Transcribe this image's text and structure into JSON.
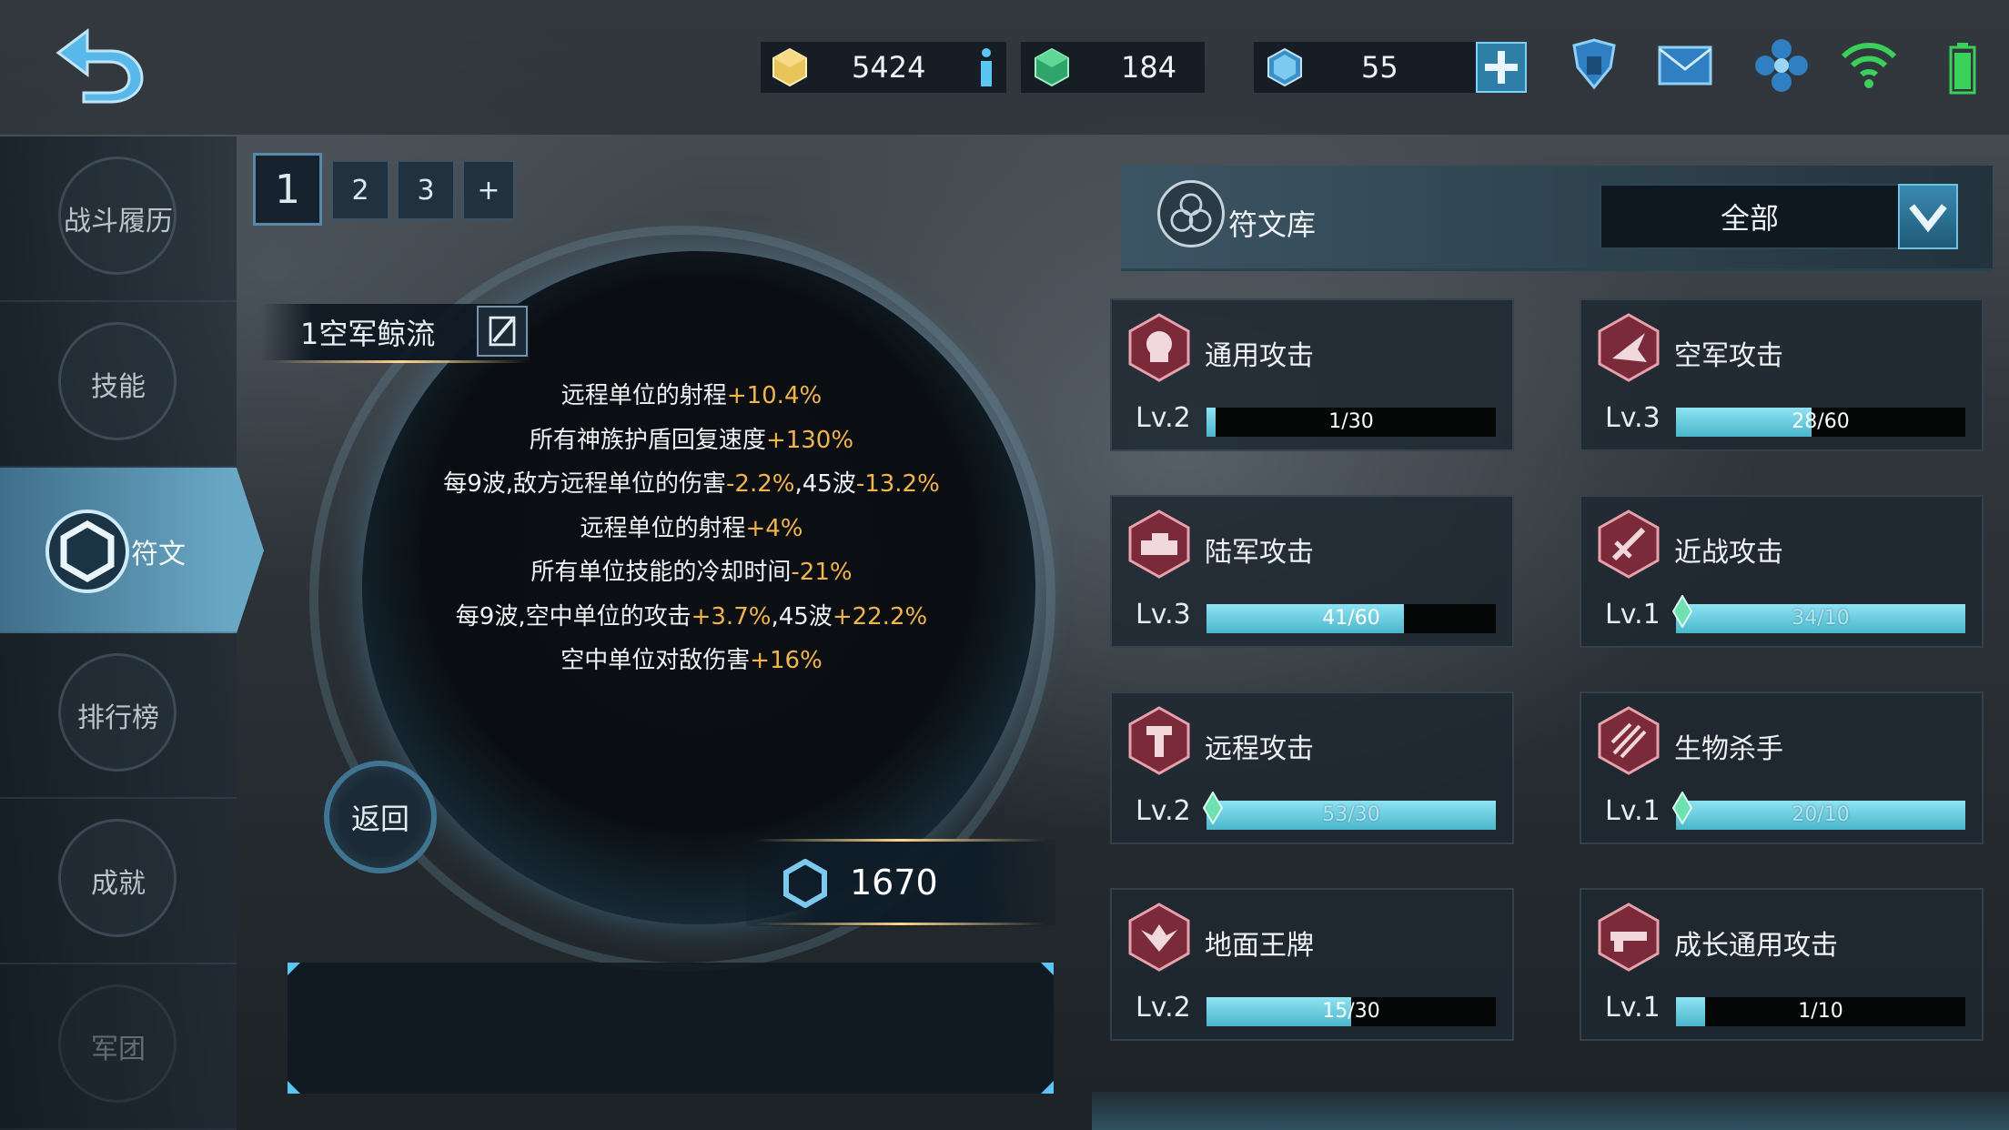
{
  "resources": [
    {
      "name": "gold",
      "value": "5424",
      "color": "#e8c35a"
    },
    {
      "name": "crystal",
      "value": "184",
      "color": "#36c27a"
    },
    {
      "name": "energy",
      "value": "55",
      "color": "#58b7e8"
    }
  ],
  "sidebar": {
    "items": [
      {
        "label": "战斗履历"
      },
      {
        "label": "技能"
      },
      {
        "label": "符文"
      },
      {
        "label": "排行榜"
      },
      {
        "label": "成就"
      },
      {
        "label": "军团"
      }
    ]
  },
  "tabs": [
    "1",
    "2",
    "3",
    "+"
  ],
  "rune_set": {
    "name": "1空军鲸流",
    "effects": [
      {
        "text": "远程单位的射程",
        "v1": "+10.4%",
        "mid": "",
        "v2": ""
      },
      {
        "text": "所有神族护盾回复速度",
        "v1": "+130%",
        "mid": "",
        "v2": ""
      },
      {
        "text": "每9波,敌方远程单位的伤害",
        "v1": "-2.2%",
        "mid": ",45波",
        "v2": "-13.2%"
      },
      {
        "text": "远程单位的射程",
        "v1": "+4%",
        "mid": "",
        "v2": ""
      },
      {
        "text": "所有单位技能的冷却时间",
        "v1": "-21%",
        "mid": "",
        "v2": ""
      },
      {
        "text": "每9波,空中单位的攻击",
        "v1": "+3.7%",
        "mid": ",45波",
        "v2": "+22.2%"
      },
      {
        "text": "空中单位对敌伤害",
        "v1": "+16%",
        "mid": "",
        "v2": ""
      }
    ],
    "return_label": "返回",
    "power": "1670"
  },
  "library": {
    "title": "符文库",
    "filter": "全部",
    "runes": [
      {
        "name": "通用攻击",
        "level": "Lv.2",
        "progress": "1/30",
        "fill": 0.033,
        "gem": false
      },
      {
        "name": "空军攻击",
        "level": "Lv.3",
        "progress": "28/60",
        "fill": 0.467,
        "gem": false
      },
      {
        "name": "陆军攻击",
        "level": "Lv.3",
        "progress": "41/60",
        "fill": 0.683,
        "gem": false
      },
      {
        "name": "近战攻击",
        "level": "Lv.1",
        "progress": "34/10",
        "fill": 1.0,
        "gem": true
      },
      {
        "name": "远程攻击",
        "level": "Lv.2",
        "progress": "53/30",
        "fill": 1.0,
        "gem": true
      },
      {
        "name": "生物杀手",
        "level": "Lv.1",
        "progress": "20/10",
        "fill": 1.0,
        "gem": true
      },
      {
        "name": "地面王牌",
        "level": "Lv.2",
        "progress": "15/30",
        "fill": 0.5,
        "gem": false
      },
      {
        "name": "成长通用攻击",
        "level": "Lv.1",
        "progress": "1/10",
        "fill": 0.1,
        "gem": false
      }
    ]
  },
  "icons": [
    "back-arrow-icon",
    "gold-cube-icon",
    "info-icon",
    "crystal-cube-icon",
    "energy-hex-icon",
    "plus-icon",
    "shield-robot-icon",
    "mail-icon",
    "settings-flower-icon",
    "wifi-icon",
    "battery-icon",
    "rune-hex-icon",
    "edit-icon",
    "chevron-down-icon"
  ]
}
